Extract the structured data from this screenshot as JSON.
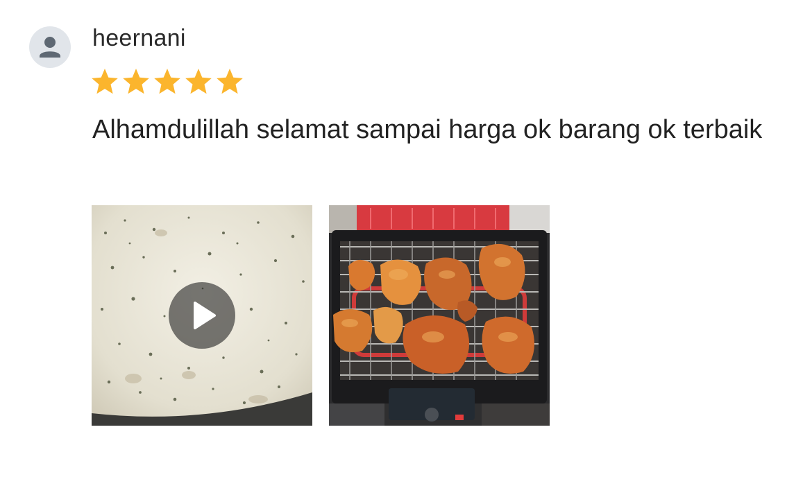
{
  "review": {
    "username": "heernani",
    "rating": 5,
    "rating_max": 5,
    "text": "Alhamdulillah selamat sampai harga ok barang ok terbaik",
    "media": [
      {
        "type": "video",
        "icon": "play-icon"
      },
      {
        "type": "photo"
      }
    ]
  },
  "colors": {
    "star": "#fbb52d",
    "avatar_bg": "#e1e5ea",
    "avatar_fg": "#5e6873"
  }
}
